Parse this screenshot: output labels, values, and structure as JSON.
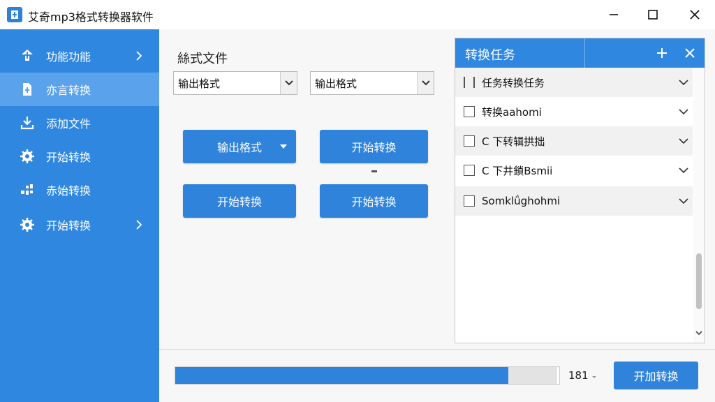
{
  "window": {
    "title": "艾奇mp3格式转换器软件"
  },
  "sidebar": {
    "items": [
      {
        "label": "功能功能",
        "icon": "upload-icon"
      },
      {
        "label": "亦言转换",
        "icon": "file-icon"
      },
      {
        "label": "添加文件",
        "icon": "download-icon"
      },
      {
        "label": "开始转换",
        "icon": "gear-icon"
      },
      {
        "label": "赤始转换",
        "icon": "grid-icon"
      },
      {
        "label": "开始转换",
        "icon": "gear-icon"
      }
    ]
  },
  "main": {
    "section_title": "絲式文件",
    "select_left": "输出格式",
    "select_right": "输出格式",
    "btn_output_format": "输出格式",
    "btn_start_1": "开始转换",
    "btn_start_2": "开始转换",
    "btn_start_3": "开始转换"
  },
  "tasks": {
    "title": "转换任务",
    "rows": [
      {
        "label": "任务转换任务"
      },
      {
        "label": "转换aahomi"
      },
      {
        "label": "C 下转辑拱拙"
      },
      {
        "label": "C 下井鎖Bsmii"
      },
      {
        "label": "Somklǘghohmi"
      }
    ]
  },
  "bottom": {
    "progress": 0.87,
    "counter": "181",
    "start_button": "开加转换"
  },
  "colors": {
    "sidebar": "#2f87e0",
    "sidebar_active": "#5aa3ec",
    "accent": "#2f83db"
  }
}
